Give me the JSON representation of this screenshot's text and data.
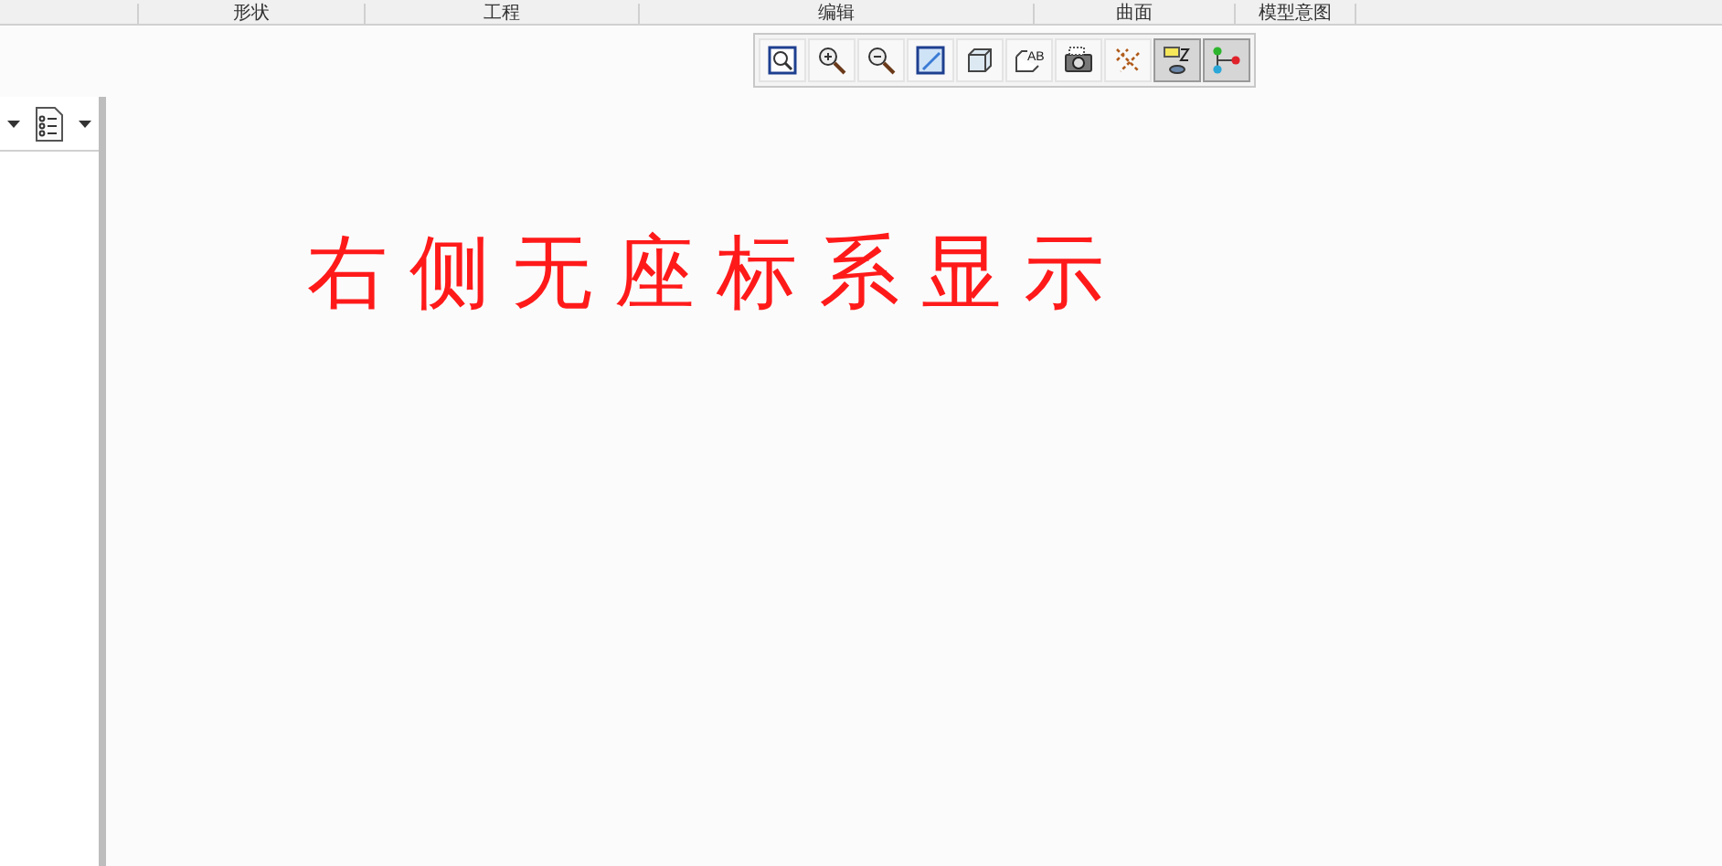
{
  "ribbon_groups": [
    {
      "label": "形状"
    },
    {
      "label": "工程"
    },
    {
      "label": "编辑"
    },
    {
      "label": "曲面"
    },
    {
      "label": "模型意图"
    }
  ],
  "view_toolbar": [
    {
      "kind": "refit",
      "selected": false
    },
    {
      "kind": "zoom_in",
      "selected": false
    },
    {
      "kind": "zoom_out",
      "selected": false
    },
    {
      "kind": "repaint",
      "selected": false
    },
    {
      "kind": "display_style",
      "selected": false
    },
    {
      "kind": "saved_views",
      "selected": false,
      "icon_text": "AB"
    },
    {
      "kind": "camera",
      "selected": false
    },
    {
      "kind": "datum_display",
      "selected": false
    },
    {
      "kind": "annotation_display",
      "selected": true
    },
    {
      "kind": "spin_center",
      "selected": true
    }
  ],
  "annotation": "右侧无座标系显示"
}
